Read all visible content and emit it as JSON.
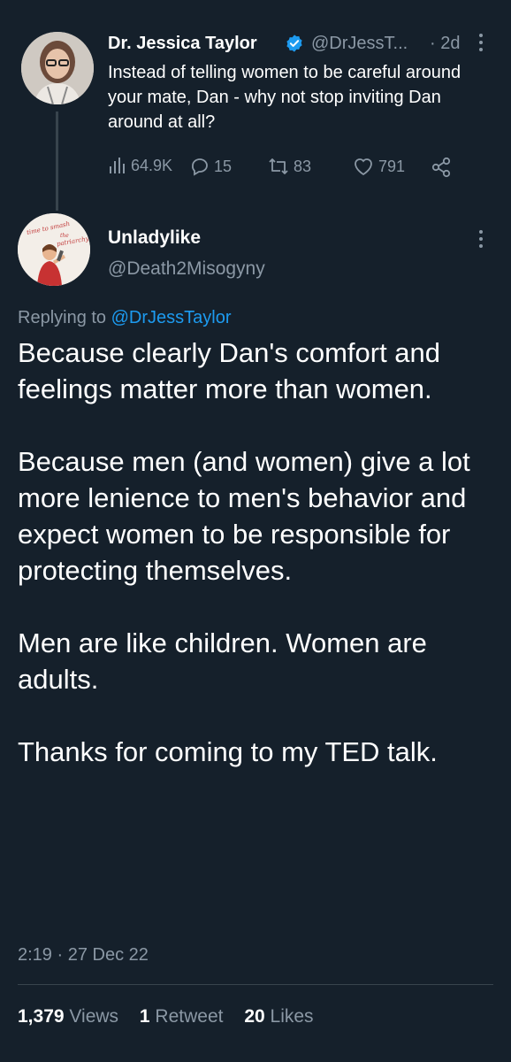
{
  "parent_tweet": {
    "author_name": "Dr. Jessica Taylor",
    "handle": "@DrJessT...",
    "time": "· 2d",
    "text": "Instead of telling women to be careful around your mate, Dan - why not stop inviting Dan around at all?",
    "views": "64.9K",
    "replies": "15",
    "retweets": "83",
    "likes": "791"
  },
  "reply_tweet": {
    "author_name": "Unladylike",
    "handle": "@Death2Misogyny",
    "replying_prefix": "Replying to ",
    "replying_handle": "@DrJessTaylor",
    "paragraphs": [
      "Because clearly Dan's comfort and feelings matter more than women.",
      "Because men (and women) give a lot more lenience to men's behavior and expect women to be responsible for protecting themselves.",
      "Men are like children. Women are adults.",
      "Thanks for coming to my TED talk."
    ],
    "timestamp": "2:19 · 27 Dec 22",
    "views_count": "1,379",
    "views_label": "Views",
    "retweets_count": "1",
    "retweets_label": "Retweet",
    "likes_count": "20",
    "likes_label": "Likes",
    "avatar_text_1": "time to smash",
    "avatar_text_2": "the",
    "avatar_text_3": "patriarchy"
  },
  "colors": {
    "background": "#15202b",
    "secondary_text": "#8b98a5",
    "link": "#1d9bf0"
  }
}
